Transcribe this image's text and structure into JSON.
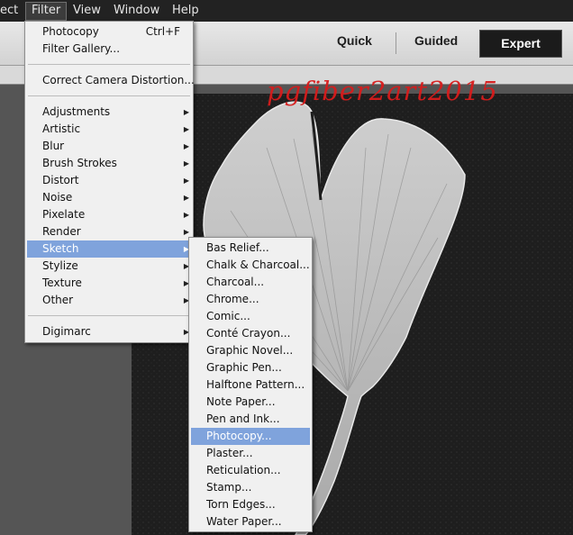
{
  "menubar": {
    "items": [
      "ect",
      "Filter",
      "View",
      "Window",
      "Help"
    ]
  },
  "modes": {
    "quick": "Quick",
    "guided": "Guided",
    "expert": "Expert"
  },
  "watermark": "pgfiber2art2015",
  "filter_menu": {
    "group1": [
      {
        "label": "Photocopy",
        "shortcut": "Ctrl+F"
      },
      {
        "label": "Filter Gallery..."
      }
    ],
    "group2": [
      {
        "label": "Correct Camera Distortion..."
      }
    ],
    "group3": [
      {
        "label": "Adjustments"
      },
      {
        "label": "Artistic"
      },
      {
        "label": "Blur"
      },
      {
        "label": "Brush Strokes"
      },
      {
        "label": "Distort"
      },
      {
        "label": "Noise"
      },
      {
        "label": "Pixelate"
      },
      {
        "label": "Render"
      },
      {
        "label": "Sketch"
      },
      {
        "label": "Stylize"
      },
      {
        "label": "Texture"
      },
      {
        "label": "Other"
      }
    ],
    "group4": [
      {
        "label": "Digimarc"
      }
    ],
    "highlighted": "Sketch"
  },
  "sketch_submenu": {
    "items": [
      "Bas Relief...",
      "Chalk & Charcoal...",
      "Charcoal...",
      "Chrome...",
      "Comic...",
      "Conté Crayon...",
      "Graphic Novel...",
      "Graphic Pen...",
      "Halftone Pattern...",
      "Note Paper...",
      "Pen and Ink...",
      "Photocopy...",
      "Plaster...",
      "Reticulation...",
      "Stamp...",
      "Torn Edges...",
      "Water Paper..."
    ],
    "highlighted": "Photocopy..."
  },
  "icons": {
    "submenu_arrow": "triangle-right-icon"
  }
}
